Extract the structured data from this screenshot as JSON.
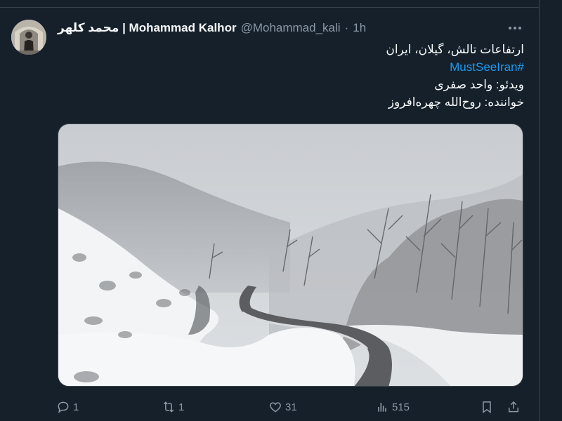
{
  "tweet": {
    "display_name": "محمد کلهر | Mohammad Kalhor",
    "handle": "@Mohammad_kali",
    "separator": "·",
    "time": "1h",
    "lines": [
      "ارتفاعات تالش، گیلان، ایران"
    ],
    "hashtag": "#MustSeeIran",
    "credits": [
      "ویدئو: واحد صفری",
      "خواننده: روح‌الله چهره‌افروز"
    ]
  },
  "media": {
    "description_icon": "snowy-mountain-road-video"
  },
  "actions": {
    "reply_count": "1",
    "retweet_count": "1",
    "like_count": "31",
    "view_count": "515"
  },
  "icons": {
    "more": "more-icon",
    "reply": "reply-icon",
    "retweet": "retweet-icon",
    "like": "heart-icon",
    "views": "views-icon",
    "bookmark": "bookmark-icon",
    "share": "share-icon"
  },
  "colors": {
    "background": "#15202b",
    "text": "#f7f9f9",
    "muted": "#8b98a5",
    "accent": "#1d9bf0",
    "border": "#38444d"
  }
}
